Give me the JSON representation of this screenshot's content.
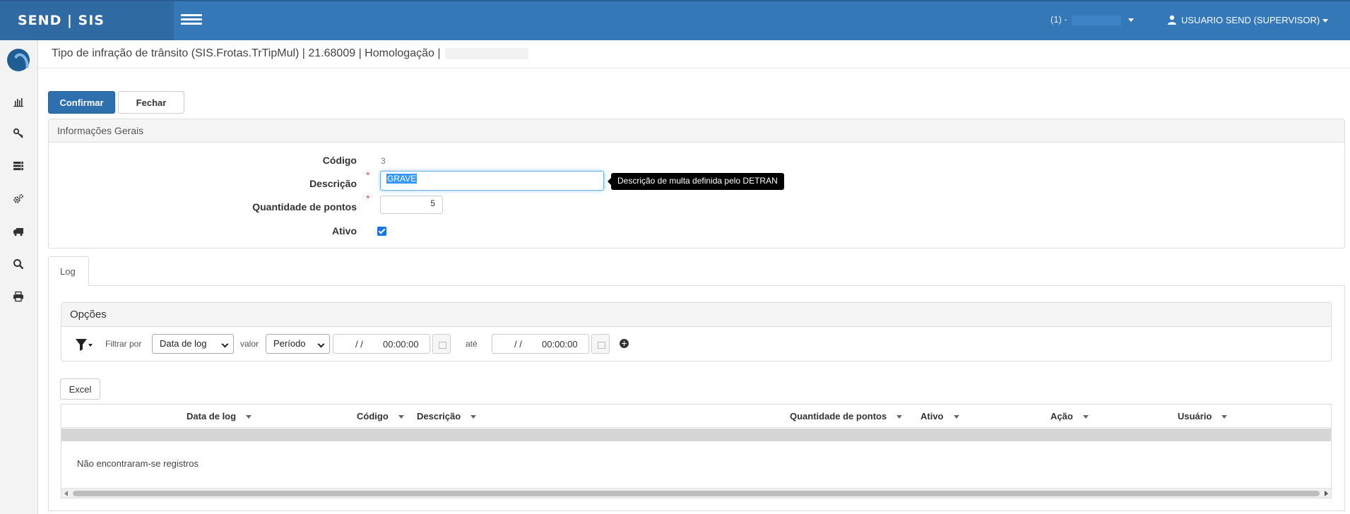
{
  "app": {
    "brand": "SEND | SIS"
  },
  "topbar": {
    "company_prefix": "(1) -",
    "user": "USUARIO SEND (SUPERVISOR)"
  },
  "colors": {
    "navbar": "#3578b8",
    "brand": "#2f6aa3",
    "primary": "#2e6fad",
    "tooltip_bg": "#000000"
  },
  "sidebar": {
    "items": [
      {
        "icon": "bar-chart-icon"
      },
      {
        "icon": "key-icon"
      },
      {
        "icon": "database-icon"
      },
      {
        "icon": "cogs-icon"
      },
      {
        "icon": "truck-icon"
      },
      {
        "icon": "search-icon"
      },
      {
        "icon": "print-icon"
      }
    ]
  },
  "page": {
    "title": "Tipo de infração de trânsito (SIS.Frotas.TrTipMul) | 21.68009 | Homologação |"
  },
  "toolbar": {
    "confirm_label": "Confirmar",
    "close_label": "Fechar"
  },
  "info": {
    "heading": "Informações Gerais",
    "codigo_label": "Código",
    "codigo_value": "3",
    "descricao_label": "Descrição",
    "descricao_value": "GRAVE",
    "descricao_tooltip": "Descrição de multa definida pelo DETRAN",
    "pontos_label": "Quantidade de pontos",
    "pontos_value": "5",
    "ativo_label": "Ativo",
    "ativo_checked": true,
    "required_mark": "*"
  },
  "tabs": [
    {
      "label": "Log"
    }
  ],
  "options": {
    "heading": "Opções",
    "filter_label": "Filtrar por",
    "filter_value": "Data de log",
    "valor_label": "valor",
    "valor_value": "Período",
    "date_from": "/ /",
    "time_from": "00:00:00",
    "ate_label": "até",
    "date_to": "/ /",
    "time_to": "00:00:00"
  },
  "excel_label": "Excel",
  "grid": {
    "columns": [
      "Data de log",
      "Código",
      "Descrição",
      "Quantidade de pontos",
      "Ativo",
      "Ação",
      "Usuário"
    ],
    "empty_message": "Não encontraram-se registros"
  }
}
